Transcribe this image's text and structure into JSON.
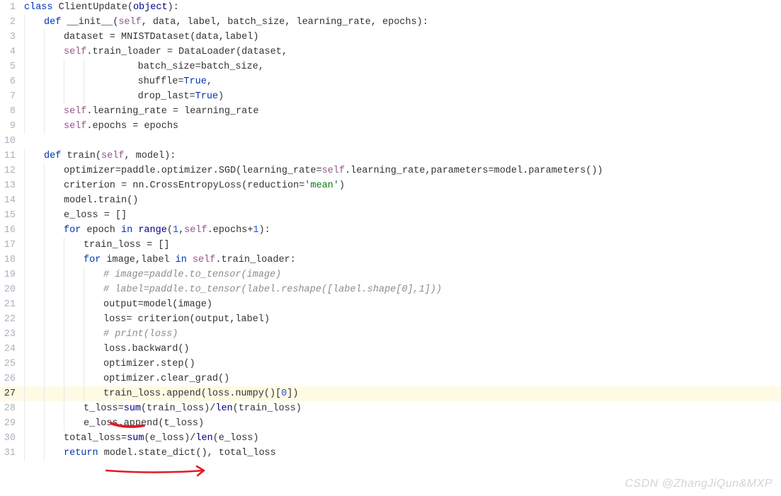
{
  "watermark": "CSDN @ZhangJiQun&MXP",
  "lines": [
    {
      "n": "1",
      "indent": 0,
      "tokens": [
        {
          "t": "class ",
          "c": "kw"
        },
        {
          "t": "ClientUpdate",
          "c": ""
        },
        {
          "t": "(",
          "c": ""
        },
        {
          "t": "object",
          "c": "builtin"
        },
        {
          "t": "):",
          "c": ""
        }
      ]
    },
    {
      "n": "2",
      "indent": 1,
      "tokens": [
        {
          "t": "def ",
          "c": "kw"
        },
        {
          "t": "__init__",
          "c": ""
        },
        {
          "t": "(",
          "c": ""
        },
        {
          "t": "self",
          "c": "self"
        },
        {
          "t": ", data, label, batch_size, learning_rate, epochs):",
          "c": ""
        }
      ]
    },
    {
      "n": "3",
      "indent": 2,
      "tokens": [
        {
          "t": "dataset = MNISTDataset(data,label)",
          "c": ""
        }
      ]
    },
    {
      "n": "4",
      "indent": 2,
      "tokens": [
        {
          "t": "self",
          "c": "self"
        },
        {
          "t": ".train_loader = DataLoader(dataset,",
          "c": ""
        }
      ]
    },
    {
      "n": "5",
      "indent": 4,
      "extra": "      ",
      "tokens": [
        {
          "t": "batch_size=batch_size,",
          "c": ""
        }
      ]
    },
    {
      "n": "6",
      "indent": 4,
      "extra": "      ",
      "tokens": [
        {
          "t": "shuffle=",
          "c": ""
        },
        {
          "t": "True",
          "c": "kw"
        },
        {
          "t": ",",
          "c": ""
        }
      ]
    },
    {
      "n": "7",
      "indent": 4,
      "extra": "      ",
      "tokens": [
        {
          "t": "drop_last=",
          "c": ""
        },
        {
          "t": "True",
          "c": "kw"
        },
        {
          "t": ")",
          "c": ""
        }
      ]
    },
    {
      "n": "8",
      "indent": 2,
      "tokens": [
        {
          "t": "self",
          "c": "self"
        },
        {
          "t": ".learning_rate = learning_rate",
          "c": ""
        }
      ]
    },
    {
      "n": "9",
      "indent": 2,
      "tokens": [
        {
          "t": "self",
          "c": "self"
        },
        {
          "t": ".epochs = epochs",
          "c": ""
        }
      ]
    },
    {
      "n": "10",
      "indent": 0,
      "tokens": []
    },
    {
      "n": "11",
      "indent": 1,
      "tokens": [
        {
          "t": "def ",
          "c": "kw"
        },
        {
          "t": "train",
          "c": ""
        },
        {
          "t": "(",
          "c": ""
        },
        {
          "t": "self",
          "c": "self"
        },
        {
          "t": ", model):",
          "c": ""
        }
      ]
    },
    {
      "n": "12",
      "indent": 2,
      "tokens": [
        {
          "t": "optimizer=paddle.optimizer.SGD(learning_rate=",
          "c": ""
        },
        {
          "t": "self",
          "c": "self"
        },
        {
          "t": ".learning_rate,parameters=model.parameters())",
          "c": ""
        }
      ]
    },
    {
      "n": "13",
      "indent": 2,
      "tokens": [
        {
          "t": "criterion = nn.CrossEntropyLoss(reduction=",
          "c": ""
        },
        {
          "t": "'mean'",
          "c": "str"
        },
        {
          "t": ")",
          "c": ""
        }
      ]
    },
    {
      "n": "14",
      "indent": 2,
      "tokens": [
        {
          "t": "model.train()",
          "c": ""
        }
      ]
    },
    {
      "n": "15",
      "indent": 2,
      "tokens": [
        {
          "t": "e_loss = []",
          "c": ""
        }
      ]
    },
    {
      "n": "16",
      "indent": 2,
      "tokens": [
        {
          "t": "for ",
          "c": "kw"
        },
        {
          "t": "epoch ",
          "c": ""
        },
        {
          "t": "in ",
          "c": "kw"
        },
        {
          "t": "range",
          "c": "builtin"
        },
        {
          "t": "(",
          "c": ""
        },
        {
          "t": "1",
          "c": "num"
        },
        {
          "t": ",",
          "c": ""
        },
        {
          "t": "self",
          "c": "self"
        },
        {
          "t": ".epochs+",
          "c": ""
        },
        {
          "t": "1",
          "c": "num"
        },
        {
          "t": "):",
          "c": ""
        }
      ]
    },
    {
      "n": "17",
      "indent": 3,
      "tokens": [
        {
          "t": "train_loss = []",
          "c": ""
        }
      ]
    },
    {
      "n": "18",
      "indent": 3,
      "tokens": [
        {
          "t": "for ",
          "c": "kw"
        },
        {
          "t": "image,label ",
          "c": ""
        },
        {
          "t": "in ",
          "c": "kw"
        },
        {
          "t": "self",
          "c": "self"
        },
        {
          "t": ".train_loader:",
          "c": ""
        }
      ]
    },
    {
      "n": "19",
      "indent": 4,
      "tokens": [
        {
          "t": "# image=paddle.to_tensor(image)",
          "c": "comment"
        }
      ]
    },
    {
      "n": "20",
      "indent": 4,
      "tokens": [
        {
          "t": "# label=paddle.to_tensor(label.reshape([label.shape[0],1]))",
          "c": "comment"
        }
      ]
    },
    {
      "n": "21",
      "indent": 4,
      "tokens": [
        {
          "t": "output=model(image)",
          "c": ""
        }
      ]
    },
    {
      "n": "22",
      "indent": 4,
      "tokens": [
        {
          "t": "loss= criterion(output,label)",
          "c": ""
        }
      ]
    },
    {
      "n": "23",
      "indent": 4,
      "tokens": [
        {
          "t": "# print(loss)",
          "c": "comment"
        }
      ]
    },
    {
      "n": "24",
      "indent": 4,
      "tokens": [
        {
          "t": "loss.backward()",
          "c": ""
        }
      ]
    },
    {
      "n": "25",
      "indent": 4,
      "tokens": [
        {
          "t": "optimizer.step()",
          "c": ""
        }
      ]
    },
    {
      "n": "26",
      "indent": 4,
      "tokens": [
        {
          "t": "optimizer.clear_grad()",
          "c": ""
        }
      ]
    },
    {
      "n": "27",
      "indent": 4,
      "current": true,
      "tokens": [
        {
          "t": "train_loss.append(loss.numpy()[",
          "c": ""
        },
        {
          "t": "0",
          "c": "num"
        },
        {
          "t": "])",
          "c": ""
        }
      ]
    },
    {
      "n": "28",
      "indent": 3,
      "tokens": [
        {
          "t": "t_loss=",
          "c": ""
        },
        {
          "t": "sum",
          "c": "builtin"
        },
        {
          "t": "(train_loss)/",
          "c": ""
        },
        {
          "t": "len",
          "c": "builtin"
        },
        {
          "t": "(train_loss)",
          "c": ""
        }
      ]
    },
    {
      "n": "29",
      "indent": 3,
      "tokens": [
        {
          "t": "e_loss.append(t_loss)",
          "c": ""
        }
      ]
    },
    {
      "n": "30",
      "indent": 2,
      "tokens": [
        {
          "t": "total_loss=",
          "c": ""
        },
        {
          "t": "sum",
          "c": "builtin"
        },
        {
          "t": "(e_loss)/",
          "c": ""
        },
        {
          "t": "len",
          "c": "builtin"
        },
        {
          "t": "(e_loss)",
          "c": ""
        }
      ]
    },
    {
      "n": "31",
      "indent": 2,
      "tokens": [
        {
          "t": "return ",
          "c": "kw"
        },
        {
          "t": "model.state_dict(), total_loss",
          "c": ""
        }
      ]
    }
  ]
}
